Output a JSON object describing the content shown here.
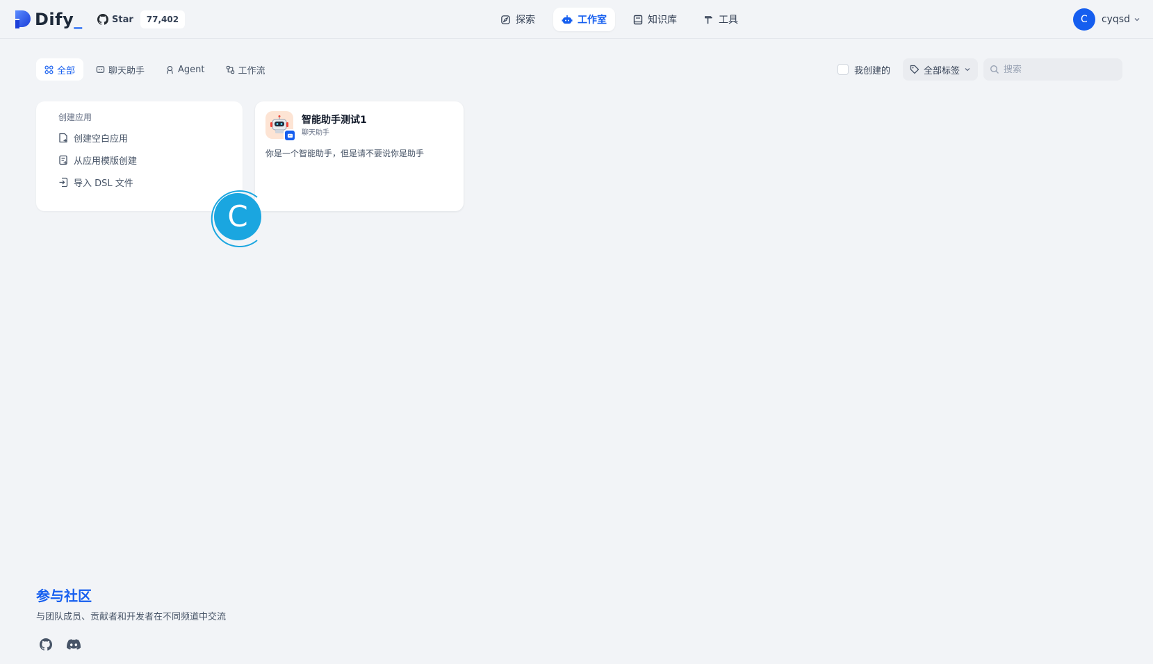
{
  "header": {
    "logo_text": "Dify",
    "logo_suffix": "_",
    "github_star_label": "Star",
    "github_star_count": "77,402",
    "nav": [
      {
        "label": "探索",
        "icon": "compass-icon"
      },
      {
        "label": "工作室",
        "icon": "robot-icon",
        "active": true
      },
      {
        "label": "知识库",
        "icon": "book-icon"
      },
      {
        "label": "工具",
        "icon": "hammer-icon"
      }
    ],
    "user": {
      "initial": "C",
      "name": "cyqsd"
    }
  },
  "toolbar": {
    "tabs": [
      {
        "label": "全部",
        "icon": "grid-icon",
        "active": true
      },
      {
        "label": "聊天助手",
        "icon": "chat-icon"
      },
      {
        "label": "Agent",
        "icon": "agent-icon"
      },
      {
        "label": "工作流",
        "icon": "workflow-icon"
      }
    ],
    "created_by_me_label": "我创建的",
    "tag_filter_label": "全部标签",
    "search_placeholder": "搜索"
  },
  "create_card": {
    "title": "创建应用",
    "items": [
      {
        "label": "创建空白应用",
        "icon": "file-plus-icon"
      },
      {
        "label": "从应用模版创建",
        "icon": "template-icon"
      },
      {
        "label": "导入 DSL 文件",
        "icon": "import-icon"
      }
    ]
  },
  "apps": [
    {
      "name": "智能助手测试1",
      "type": "聊天助手",
      "description": "你是一个智能助手，但是请不要说你是助手"
    }
  ],
  "cursor_badge": "C",
  "community": {
    "title": "参与社区",
    "subtitle": "与团队成员、贡献者和开发者在不同频道中交流"
  },
  "colors": {
    "accent": "#155eef",
    "background": "#f2f4f7",
    "spinner": "#1aa6e0"
  }
}
